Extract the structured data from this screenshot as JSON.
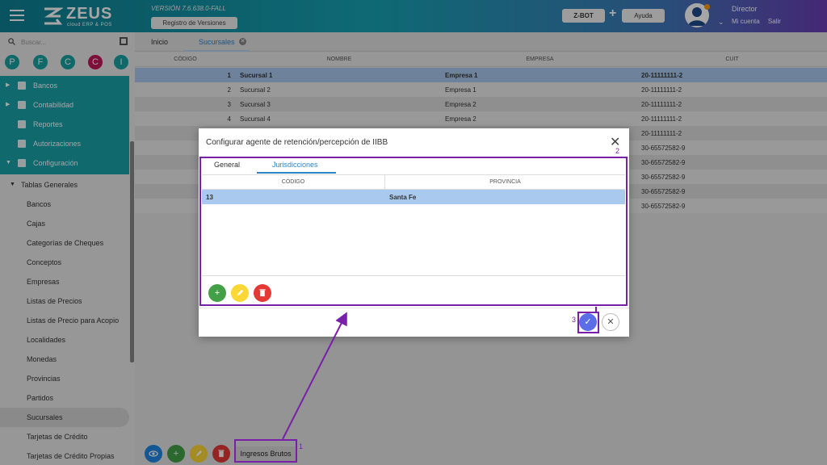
{
  "header": {
    "logo_title": "ZEUS",
    "logo_subtitle": "cloud ERP & POS",
    "version": "VERSIÓN 7.6.638.0-FALL",
    "registro_label": "Registro de Versiones",
    "zbot_label": "Z-BOT",
    "plus": "+",
    "ayuda_label": "Ayuda",
    "user_name": "Director",
    "mi_cuenta": "Mi cuenta",
    "salir": "Salir"
  },
  "sidebar": {
    "search_placeholder": "Buscar...",
    "circles": [
      {
        "letter": "P",
        "color": "#17a2a2"
      },
      {
        "letter": "F",
        "color": "#17a2a2"
      },
      {
        "letter": "C",
        "color": "#17a2a2"
      },
      {
        "letter": "C",
        "color": "#c2185b"
      },
      {
        "letter": "I",
        "color": "#17a2a2"
      }
    ],
    "main_items": [
      "Bancos",
      "Contabilidad",
      "Reportes",
      "Autorizaciones",
      "Configuración"
    ],
    "group_label": "Tablas Generales",
    "sub_items": [
      "Bancos",
      "Cajas",
      "Categorías de Cheques",
      "Conceptos",
      "Empresas",
      "Listas de Precios",
      "Listas de Precio para Acopio",
      "Localidades",
      "Monedas",
      "Provincias",
      "Partidos",
      "Sucursales",
      "Tarjetas de Crédito",
      "Tarjetas de Crédito Propias"
    ],
    "active_sub": "Sucursales"
  },
  "tabs": {
    "inicio": "Inicio",
    "sucursales": "Sucursales"
  },
  "grid": {
    "headers": [
      "CÓDIGO",
      "NOMBRE",
      "EMPRESA",
      "CUIT"
    ],
    "rows": [
      {
        "codigo": "1",
        "nombre": "Sucursal 1",
        "empresa": "Empresa 1",
        "cuit": "20-11111111-2"
      },
      {
        "codigo": "2",
        "nombre": "Sucursal 2",
        "empresa": "Empresa 1",
        "cuit": "20-11111111-2"
      },
      {
        "codigo": "3",
        "nombre": "Sucursal 3",
        "empresa": "Empresa 2",
        "cuit": "20-11111111-2"
      },
      {
        "codigo": "4",
        "nombre": "Sucursal 4",
        "empresa": "Empresa 2",
        "cuit": "20-11111111-2"
      },
      {
        "codigo": "",
        "nombre": "",
        "empresa": "",
        "cuit": "20-11111111-2"
      },
      {
        "codigo": "",
        "nombre": "",
        "empresa": "",
        "cuit": "30-65572582-9"
      },
      {
        "codigo": "",
        "nombre": "",
        "empresa": "",
        "cuit": "30-65572582-9"
      },
      {
        "codigo": "",
        "nombre": "",
        "empresa": "",
        "cuit": "30-65572582-9"
      },
      {
        "codigo": "",
        "nombre": "",
        "empresa": "",
        "cuit": "30-65572582-9"
      },
      {
        "codigo": "",
        "nombre": "",
        "empresa": "",
        "cuit": "30-65572582-9"
      }
    ]
  },
  "bottom": {
    "ingresos_label": "Ingresos Brutos"
  },
  "dialog": {
    "title": "Configurar agente de retención/percepción de IIBB",
    "tab_general": "General",
    "tab_jurisdicciones": "Jurisdicciones",
    "headers": [
      "CÓDIGO",
      "PROVINCIA"
    ],
    "row": {
      "codigo": "13",
      "provincia": "Santa Fe"
    }
  },
  "annotations": [
    "1",
    "2",
    "3"
  ],
  "colors": {
    "accent": "#2f84c6",
    "teal": "#17a2a8",
    "annotation": "#7a1fa8",
    "green": "#43a047",
    "yellow": "#fdd835",
    "red": "#e53935",
    "blue": "#1e88e5"
  }
}
